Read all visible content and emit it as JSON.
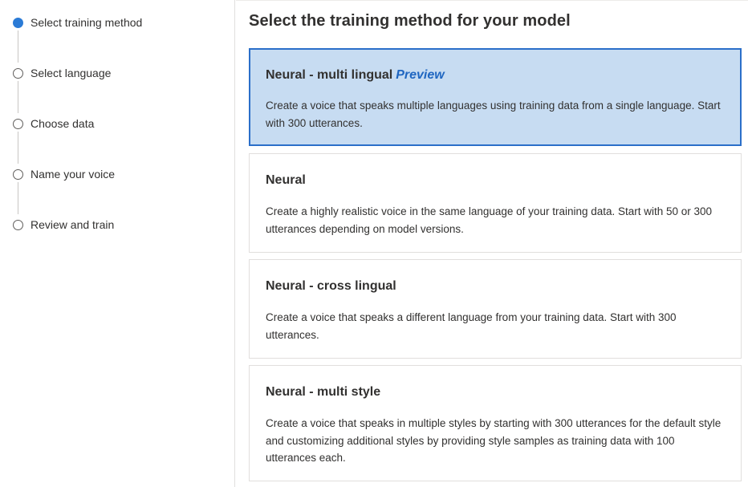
{
  "stepper": {
    "steps": [
      {
        "label": "Select training method",
        "active": true
      },
      {
        "label": "Select language",
        "active": false
      },
      {
        "label": "Choose data",
        "active": false
      },
      {
        "label": "Name your voice",
        "active": false
      },
      {
        "label": "Review and train",
        "active": false
      }
    ]
  },
  "main": {
    "title": "Select the training method for your model",
    "options": [
      {
        "title": "Neural - multi lingual",
        "badge": "Preview",
        "description": "Create a voice that speaks multiple languages using training data from a single language. Start with 300 utterances.",
        "selected": true
      },
      {
        "title": "Neural",
        "badge": "",
        "description": "Create a highly realistic voice in the same language of your training data. Start with 50 or 300 utterances depending on model versions.",
        "selected": false
      },
      {
        "title": "Neural - cross lingual",
        "badge": "",
        "description": "Create a voice that speaks a different language from your training data. Start with 300 utterances.",
        "selected": false
      },
      {
        "title": "Neural - multi style",
        "badge": "",
        "description": "Create a voice that speaks in multiple styles by starting with 300 utterances for the default style and customizing additional styles by providing style samples as training data with 100 utterances each.",
        "selected": false
      }
    ]
  },
  "colors": {
    "accent": "#2b7bd6",
    "selected_background": "#c7dcf2",
    "selected_border": "#2b6fc9",
    "preview_badge": "#1f66c1"
  }
}
